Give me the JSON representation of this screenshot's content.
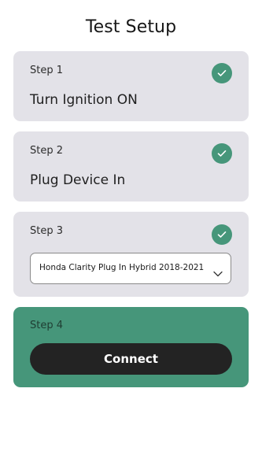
{
  "page": {
    "title": "Test Setup"
  },
  "steps": [
    {
      "label": "Step 1",
      "text": "Turn Ignition ON",
      "status": "check-icon"
    },
    {
      "label": "Step 2",
      "text": "Plug Device In",
      "status": "check-icon"
    },
    {
      "label": "Step 3",
      "vehicle_select": {
        "selected": "Honda Clarity Plug In Hybrid 2018-2021",
        "icon": "chevron-down-icon"
      },
      "status": "check-icon"
    },
    {
      "label": "Step 4",
      "button_label": "Connect"
    }
  ],
  "colors": {
    "accent": "#46967a",
    "card": "#e3e2e8",
    "button": "#232323"
  }
}
